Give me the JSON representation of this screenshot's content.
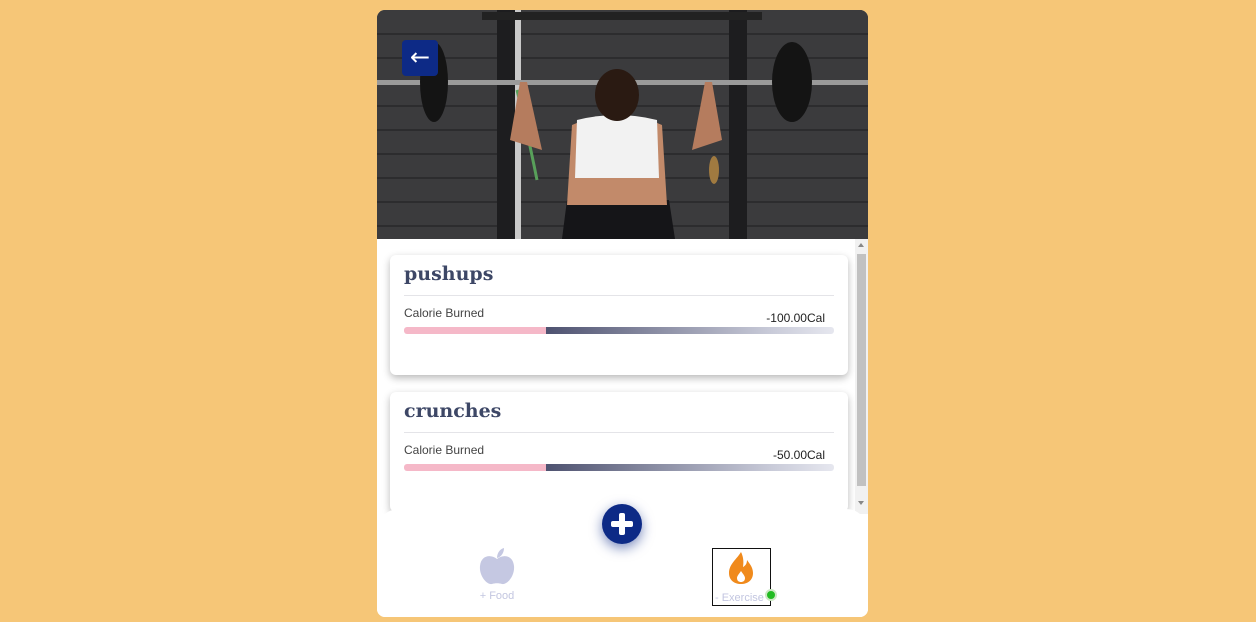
{
  "header": {
    "back_label": "←",
    "back_icon": "left-arrow-icon",
    "hero_image": "woman lifting barbell in gym"
  },
  "exercises": [
    {
      "name": "pushups",
      "metric_label": "Calorie Burned",
      "value": "-100.00Cal"
    },
    {
      "name": "crunches",
      "metric_label": "Calorie Burned",
      "value": "-50.00Cal"
    }
  ],
  "bottom_nav": {
    "add_icon": "plus-icon",
    "items": [
      {
        "label": "+ Food",
        "icon": "apple-icon"
      },
      {
        "label": "- Exercise",
        "icon": "flame-icon"
      }
    ],
    "active": "- Exercise"
  },
  "colors": {
    "background": "#f6c677",
    "accent": "#0d2a86",
    "flame": "#f08a1c",
    "active_dot": "#22bb22",
    "bar_pink": "#f5b8c8"
  }
}
